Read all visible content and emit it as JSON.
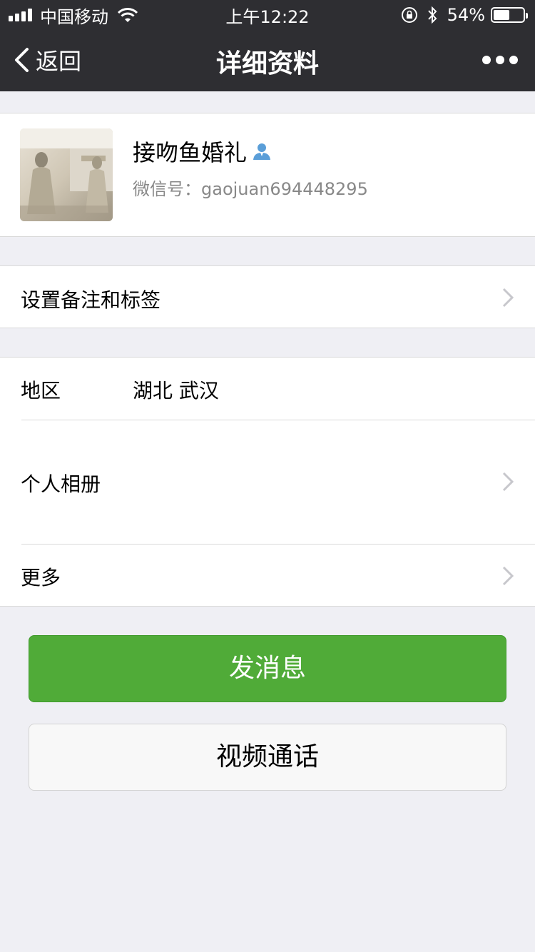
{
  "status_bar": {
    "carrier": "中国移动",
    "time": "上午12:22",
    "battery_percent": "54%",
    "battery_level": 0.54
  },
  "nav": {
    "back_label": "返回",
    "title": "详细资料",
    "more_icon": "ellipsis-icon"
  },
  "profile": {
    "name": "接吻鱼婚礼",
    "wechat_id": "微信号：gaojuan694448295",
    "badge_icon": "person-icon"
  },
  "rows": {
    "remark_label": "设置备注和标签",
    "region_label": "地区",
    "region_value": "湖北 武汉",
    "album_label": "个人相册",
    "more_label": "更多"
  },
  "buttons": {
    "send_message": "发消息",
    "video_call": "视频通话"
  },
  "colors": {
    "nav_background": "#2e2e32",
    "page_background": "#efeff4",
    "primary_green": "#50ab38"
  }
}
